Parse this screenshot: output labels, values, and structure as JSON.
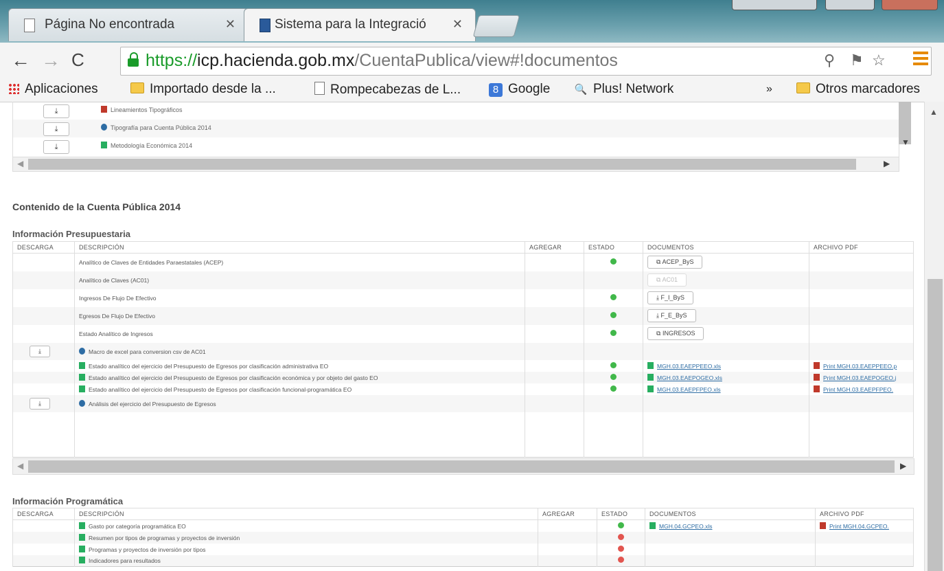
{
  "browser": {
    "tabs": [
      {
        "label": "Página No encontrada",
        "active": false
      },
      {
        "label": "Sistema para la Integració",
        "active": true
      }
    ],
    "url": {
      "scheme": "https://",
      "host": "icp.hacienda.gob.mx",
      "path": "/CuentaPublica/view#!documentos"
    },
    "bookmarks": {
      "apps": "Aplicaciones",
      "items": [
        "Importado desde la ...",
        "Rompecabezas de L...",
        "Google",
        "Plus! Network"
      ],
      "overflow": "»",
      "other": "Otros marcadores"
    }
  },
  "top_fragment": {
    "rows": [
      {
        "icon": "pdf",
        "text": "Lineamientos Tipográficos"
      },
      {
        "icon": "web",
        "text": "Tipografía para Cuenta Pública 2014"
      },
      {
        "icon": "xls",
        "text": "Metodología Económica 2014"
      }
    ]
  },
  "page": {
    "main_title": "Contenido de la Cuenta Pública 2014",
    "budget": {
      "title": "Información Presupuestaria",
      "columns": [
        "DESCARGA",
        "DESCRIPCIÓN",
        "AGREGAR",
        "ESTADO",
        "DOCUMENTOS",
        "ARCHIVO PDF"
      ],
      "rows": [
        {
          "download": false,
          "icon": "",
          "desc": "Analítico de Claves de Entidades Paraestatales (ACEP)",
          "status": "green",
          "doc_btn": "ACEP_ByS",
          "doc_btn_icon": "external",
          "doc_btn_disabled": false,
          "doc_link": "",
          "pdf": ""
        },
        {
          "download": false,
          "icon": "",
          "desc": "Analítico de Claves (AC01)",
          "status": "",
          "doc_btn": "AC01",
          "doc_btn_icon": "external",
          "doc_btn_disabled": true,
          "doc_link": "",
          "pdf": ""
        },
        {
          "download": false,
          "icon": "",
          "desc": "Ingresos De Flujo De Efectivo",
          "status": "green",
          "doc_btn": "F_I_ByS",
          "doc_btn_icon": "download",
          "doc_btn_disabled": false,
          "doc_link": "",
          "pdf": ""
        },
        {
          "download": false,
          "icon": "",
          "desc": "Egresos De Flujo De Efectivo",
          "status": "green",
          "doc_btn": "F_E_ByS",
          "doc_btn_icon": "download",
          "doc_btn_disabled": false,
          "doc_link": "",
          "pdf": ""
        },
        {
          "download": false,
          "icon": "",
          "desc": "Estado Analítico de Ingresos",
          "status": "green",
          "doc_btn": "INGRESOS",
          "doc_btn_icon": "external",
          "doc_btn_disabled": false,
          "doc_link": "",
          "pdf": ""
        },
        {
          "download": true,
          "icon": "web",
          "desc": "Macro de excel para conversion csv de AC01",
          "status": "",
          "doc_btn": "",
          "doc_btn_icon": "",
          "doc_btn_disabled": false,
          "doc_link": "",
          "pdf": ""
        },
        {
          "download": false,
          "icon": "xls",
          "desc": "Estado analítico del ejercicio del Presupuesto de Egresos por clasificación administrativa EO",
          "status": "green",
          "doc_btn": "",
          "doc_btn_icon": "",
          "doc_btn_disabled": false,
          "doc_link": "MGH.03.EAEPPEEO.xls",
          "pdf": "Print MGH.03.EAEPPEEO.p"
        },
        {
          "download": false,
          "icon": "xls",
          "desc": "Estado analítico del ejercicio del Presupuesto de Egresos por clasificación económica y por objeto del gasto EO",
          "status": "green",
          "doc_btn": "",
          "doc_btn_icon": "",
          "doc_btn_disabled": false,
          "doc_link": "MGH.03.EAEPOGEO.xls",
          "pdf": "Print MGH.03.EAEPOGEO.j"
        },
        {
          "download": false,
          "icon": "xls",
          "desc": "Estado analítico del ejercicio del Presupuesto de Egresos por clasificación funcional-programática EO",
          "status": "green",
          "doc_btn": "",
          "doc_btn_icon": "",
          "doc_btn_disabled": false,
          "doc_link": "MGH.03.EAEPFPEO.xls",
          "pdf": "Print MGH.03.EAEPFPEO."
        },
        {
          "download": true,
          "icon": "web",
          "desc": "Análisis del ejercicio del Presupuesto de Egresos",
          "status": "",
          "doc_btn": "",
          "doc_btn_icon": "",
          "doc_btn_disabled": false,
          "doc_link": "",
          "pdf": ""
        }
      ]
    },
    "programmatic": {
      "title": "Información Programática",
      "columns": [
        "DESCARGA",
        "DESCRIPCIÓN",
        "AGREGAR",
        "ESTADO",
        "DOCUMENTOS",
        "ARCHIVO PDF"
      ],
      "rows": [
        {
          "icon": "xls",
          "desc": "Gasto por categoría programática EO",
          "status": "green",
          "doc_link": "MGH.04.GCPEO.xls",
          "pdf": "Print MGH.04.GCPEO."
        },
        {
          "icon": "xls",
          "desc": "Resumen por tipos de programas y proyectos de inversión",
          "status": "red",
          "doc_link": "",
          "pdf": ""
        },
        {
          "icon": "xls",
          "desc": "Programas y proyectos de inversión por tipos",
          "status": "red",
          "doc_link": "",
          "pdf": ""
        },
        {
          "icon": "xls",
          "desc": "Indicadores para resultados",
          "status": "red",
          "doc_link": "",
          "pdf": ""
        }
      ]
    }
  }
}
